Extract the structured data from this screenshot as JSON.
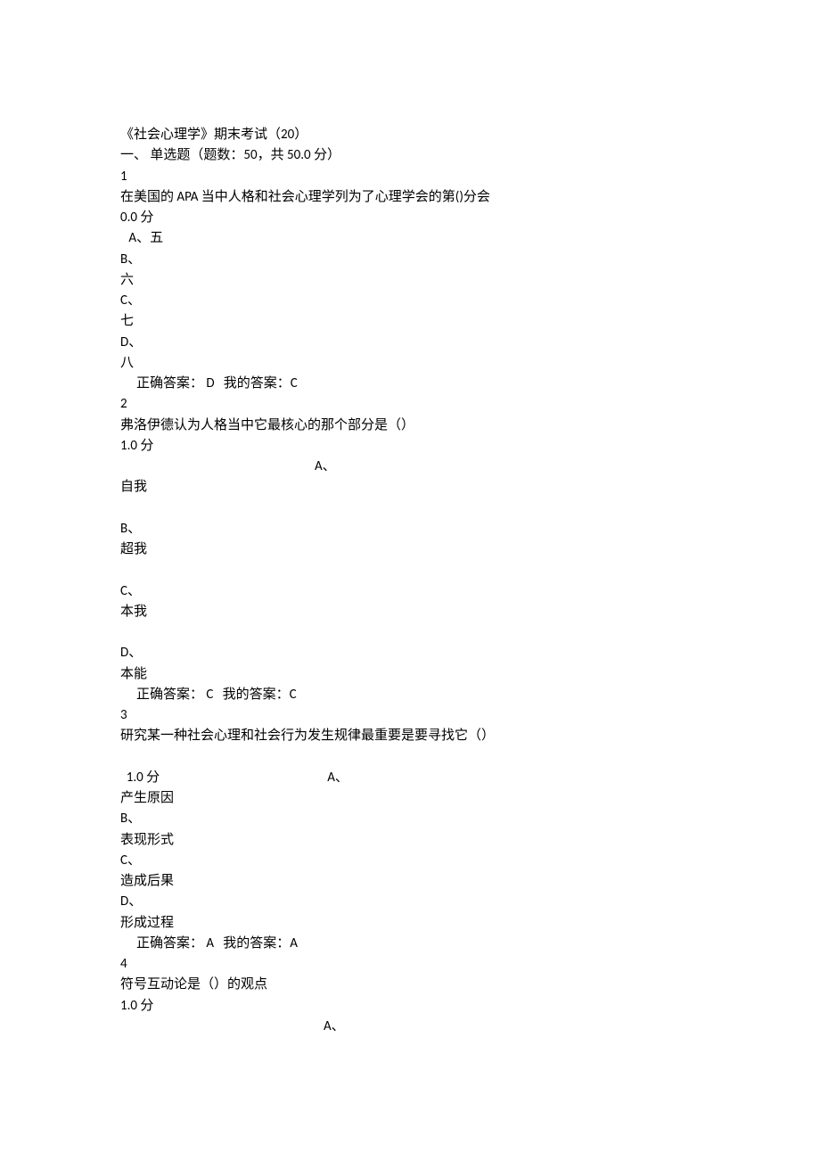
{
  "header": {
    "title": "《社会心理学》期末考试（20）",
    "section": "一、 单选题（题数：50，共 50.0 分）"
  },
  "q1": {
    "num": "1",
    "text": "在美国的 APA 当中人格和社会心理学列为了心理学会的第()分会",
    "score": "0.0 分",
    "optA_label": " A、五",
    "optB_label": "B、",
    "optB_text": "六",
    "optC_label": "C、",
    "optC_text": "七",
    "optD_label": "D、",
    "optD_text": "八",
    "answer": "正确答案： D   我的答案：C"
  },
  "q2": {
    "num": "2",
    "text": "弗洛伊德认为人格当中它最核心的那个部分是（）",
    "score": "1.0 分",
    "optA_label": "A、",
    "optA_text": "自我",
    "optB_label": "B、",
    "optB_text": "超我",
    "optC_label": "C、",
    "optC_text": "本我",
    "optD_label": "D、",
    "optD_text": "本能",
    "answer": "正确答案： C   我的答案：C"
  },
  "q3": {
    "num": "3",
    "text": "研究某一种社会心理和社会行为发生规律最重要是要寻找它（）",
    "score_label": "1.0 分",
    "optA_label": "A、",
    "optA_text": "产生原因",
    "optB_label": "B、",
    "optB_text": "表现形式",
    "optC_label": "C、",
    "optC_text": "造成后果",
    "optD_label": "D、",
    "optD_text": "形成过程",
    "answer": "正确答案： A   我的答案：A"
  },
  "q4": {
    "num": "4",
    "text": "符号互动论是（）的观点",
    "score": "1.0 分",
    "optA_label": "A、"
  }
}
